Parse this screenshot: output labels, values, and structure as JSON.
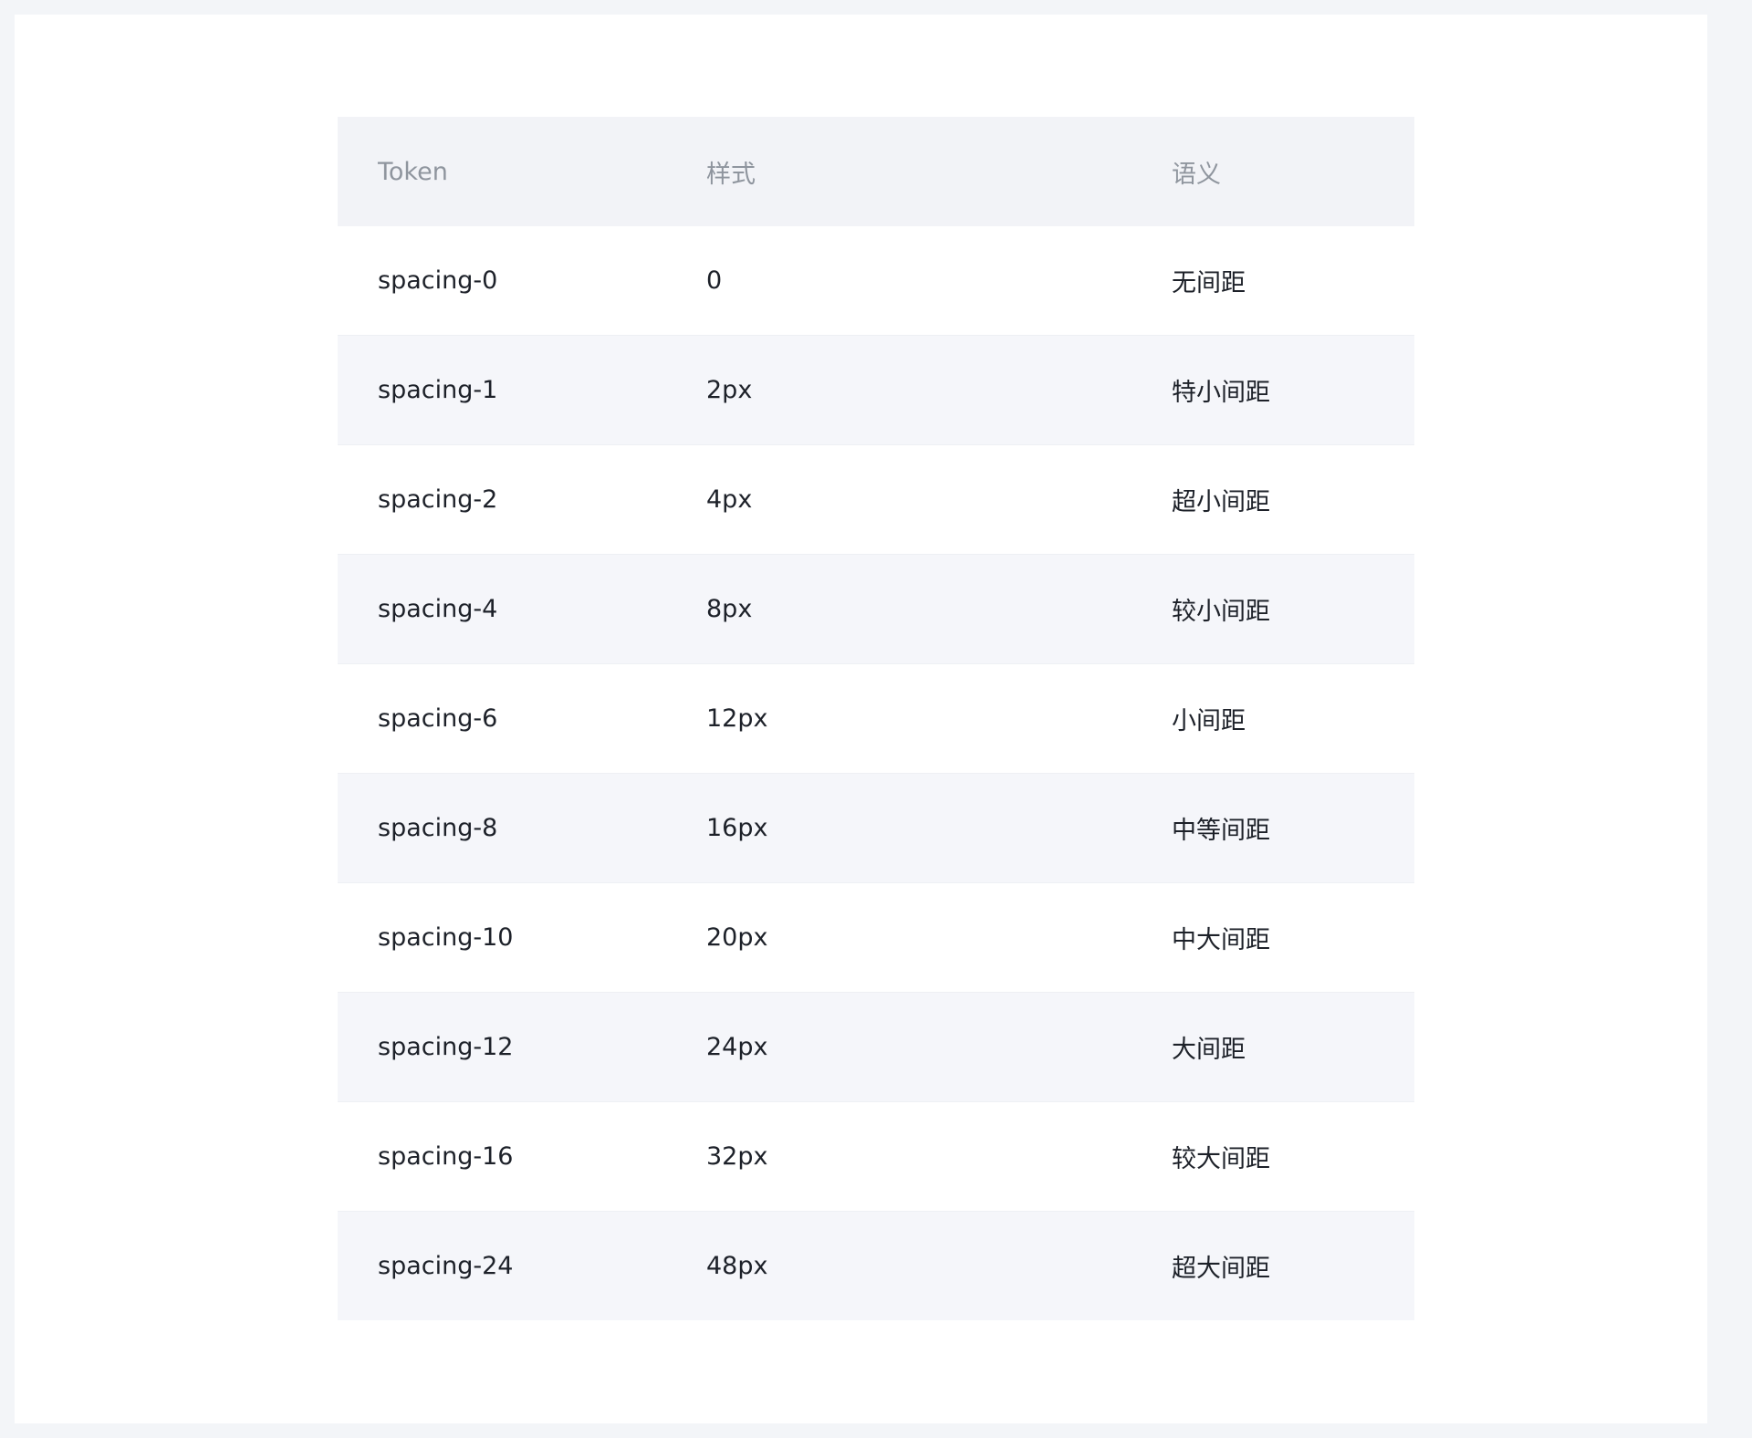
{
  "table": {
    "headers": [
      "Token",
      "样式",
      "语义"
    ],
    "rows": [
      {
        "token": "spacing-0",
        "style": "0",
        "meaning": "无间距"
      },
      {
        "token": "spacing-1",
        "style": "2px",
        "meaning": "特小间距"
      },
      {
        "token": "spacing-2",
        "style": "4px",
        "meaning": "超小间距"
      },
      {
        "token": "spacing-4",
        "style": "8px",
        "meaning": "较小间距"
      },
      {
        "token": "spacing-6",
        "style": "12px",
        "meaning": "小间距"
      },
      {
        "token": "spacing-8",
        "style": "16px",
        "meaning": "中等间距"
      },
      {
        "token": "spacing-10",
        "style": "20px",
        "meaning": "中大间距"
      },
      {
        "token": "spacing-12",
        "style": "24px",
        "meaning": "大间距"
      },
      {
        "token": "spacing-16",
        "style": "32px",
        "meaning": "较大间距"
      },
      {
        "token": "spacing-24",
        "style": "48px",
        "meaning": "超大间距"
      }
    ]
  }
}
